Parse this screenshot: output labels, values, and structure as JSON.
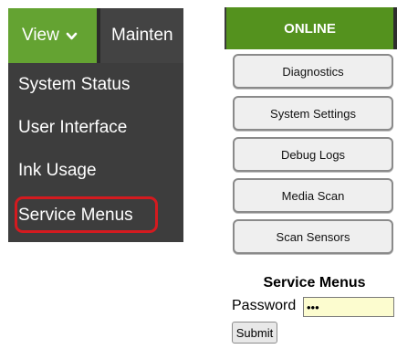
{
  "menu": {
    "tabs": [
      {
        "label": "View",
        "active": true,
        "icon": "chevron-down-icon"
      },
      {
        "label": "Mainten",
        "active": false
      }
    ],
    "items": [
      {
        "label": "System Status"
      },
      {
        "label": "User Interface"
      },
      {
        "label": "Ink Usage"
      },
      {
        "label": "Service Menus",
        "highlighted": true
      }
    ],
    "colors": {
      "active_tab": "#64a332",
      "panel": "#3d3d3d",
      "highlight_ring": "#d41a1f"
    }
  },
  "panel": {
    "status": "ONLINE",
    "status_color": "#54921e",
    "buttons": [
      {
        "label": "Diagnostics"
      },
      {
        "label": "System Settings"
      },
      {
        "label": "Debug Logs"
      },
      {
        "label": "Media Scan"
      },
      {
        "label": "Scan Sensors"
      }
    ],
    "service": {
      "title": "Service Menus",
      "password_label": "Password",
      "password_value": "•••",
      "submit_label": "Submit"
    }
  }
}
